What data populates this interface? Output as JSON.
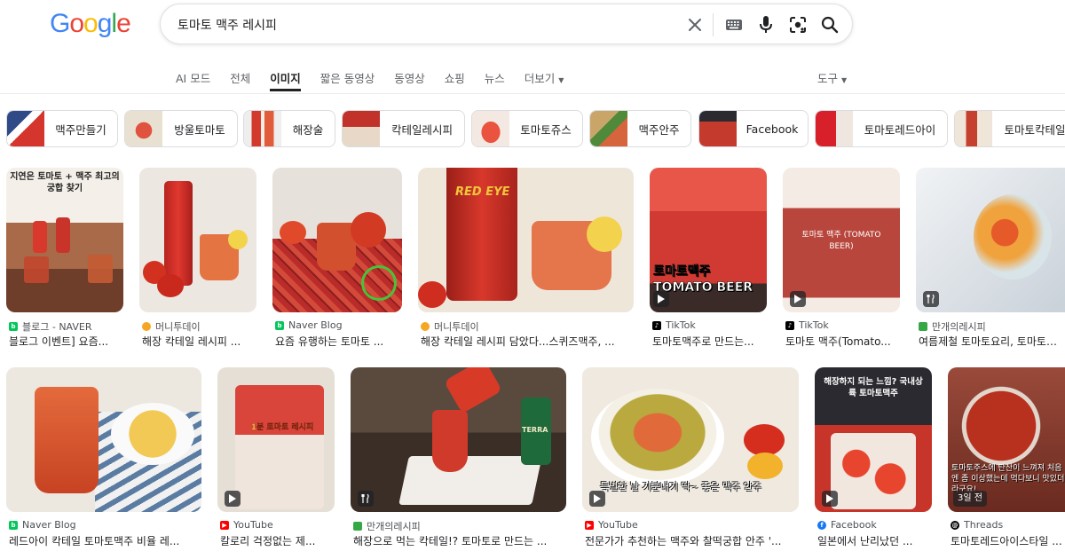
{
  "header": {
    "logo_letters": [
      "G",
      "o",
      "o",
      "g",
      "l",
      "e"
    ],
    "logo_colors": [
      "#4285F4",
      "#EA4335",
      "#FBBC05",
      "#4285F4",
      "#34A853",
      "#EA4335"
    ],
    "query": "토마토 맥주 레시피",
    "icons": [
      "close-icon",
      "keyboard-icon",
      "microphone-icon",
      "lens-icon",
      "search-icon"
    ]
  },
  "tabs": [
    {
      "label": "AI 모드",
      "active": false
    },
    {
      "label": "전체",
      "active": false
    },
    {
      "label": "이미지",
      "active": true
    },
    {
      "label": "짧은 동영상",
      "active": false
    },
    {
      "label": "동영상",
      "active": false
    },
    {
      "label": "쇼핑",
      "active": false
    },
    {
      "label": "뉴스",
      "active": false
    },
    {
      "label": "더보기",
      "active": false,
      "dropdown": true
    }
  ],
  "tools_label": "도구",
  "chips": [
    {
      "label": "맥주만들기",
      "color": "#7a4a3a"
    },
    {
      "label": "방울토마토",
      "color": "#c9463a"
    },
    {
      "label": "해장술",
      "color": "#d43a2c"
    },
    {
      "label": "칵테일레시피",
      "color": "#b8302a"
    },
    {
      "label": "토마토쥬스",
      "color": "#e35a4a"
    },
    {
      "label": "맥주안주",
      "color": "#b86a3a"
    },
    {
      "label": "Facebook",
      "color": "#a02a22"
    },
    {
      "label": "토마토레드아이",
      "color": "#d8202a"
    },
    {
      "label": "토마토칵테일",
      "color": "#c5402e"
    }
  ],
  "row1": [
    {
      "source": "블로그 - NAVER",
      "caption": "블로그 이벤트] 요즘...",
      "fav": "#03c75a",
      "bg": "#9c6b4e",
      "overlay": "지연은 토마토 + 맥주 최고의 궁합 찾기"
    },
    {
      "source": "머니투데이",
      "caption": "해장 칵테일 레시피 ...",
      "fav": "#f5a623",
      "bg": "#e9e4dd",
      "overlay": ""
    },
    {
      "source": "Naver Blog",
      "caption": "요즘 유행하는 토마토 ...",
      "fav": "#03c75a",
      "bg": "#c3342e",
      "overlay": ""
    },
    {
      "source": "머니투데이",
      "caption": "해장 칵테일 레시피 담았다...스퀴즈맥주, ...",
      "fav": "#f5a623",
      "bg": "#efe5d6",
      "overlay": "RED EYE"
    },
    {
      "source": "TikTok",
      "caption": "토마토맥주로 만드는...",
      "fav": "#000000",
      "bg": "#d9413a",
      "overlay": "토마토맥주 TOMATO BEER"
    },
    {
      "source": "TikTok",
      "caption": "토마토 맥주(Tomato...",
      "fav": "#000000",
      "bg": "#b8463c",
      "overlay": "토마토 맥주 (TOMATO BEER)"
    },
    {
      "source": "만개의레시피",
      "caption": "여름제철 토마토요리, 토마토마리네이드",
      "fav": "#35a845",
      "bg": "#d8dde2",
      "overlay": ""
    }
  ],
  "row2": [
    {
      "source": "Naver Blog",
      "caption": "레드아이 칵테일 토마토맥주 비율 레...",
      "fav": "#03c75a",
      "bg": "#ece7df",
      "overlay": ""
    },
    {
      "source": "YouTube",
      "caption": "칼로리 걱정없는 제...",
      "fav": "#ff0000",
      "bg": "#e6dfd6",
      "overlay": "1분 토마토 레시피"
    },
    {
      "source": "만개의레시피",
      "caption": "해장으로 먹는 칵테일!? 토마토로 만드는 ...",
      "fav": "#35a845",
      "bg": "#5a4a3e",
      "overlay": "TERRA"
    },
    {
      "source": "YouTube",
      "caption": "전문가가 추천하는 맥주와 찰떡궁합 안주 '...",
      "fav": "#ff0000",
      "bg": "#e8d9b8",
      "overlay": "특별한 날 기분내기 딱~ 좋은 맥주 안주"
    },
    {
      "source": "Facebook",
      "caption": "일본에서 난리났던 ...",
      "fav": "#1877f2",
      "bg": "#2a2a30",
      "overlay": "해장하지 되는 느낌? 국내상륙 토마토맥주"
    },
    {
      "source": "Threads",
      "caption": "토마토레드아이스타일 ...",
      "fav": "#000000",
      "bg": "#8a3a2c",
      "overlay": "토마토주스에 탄산이 느껴져 처음엔 좀 이상했는데 먹다보니 맛있더라구요!",
      "time": "3일 전"
    }
  ]
}
